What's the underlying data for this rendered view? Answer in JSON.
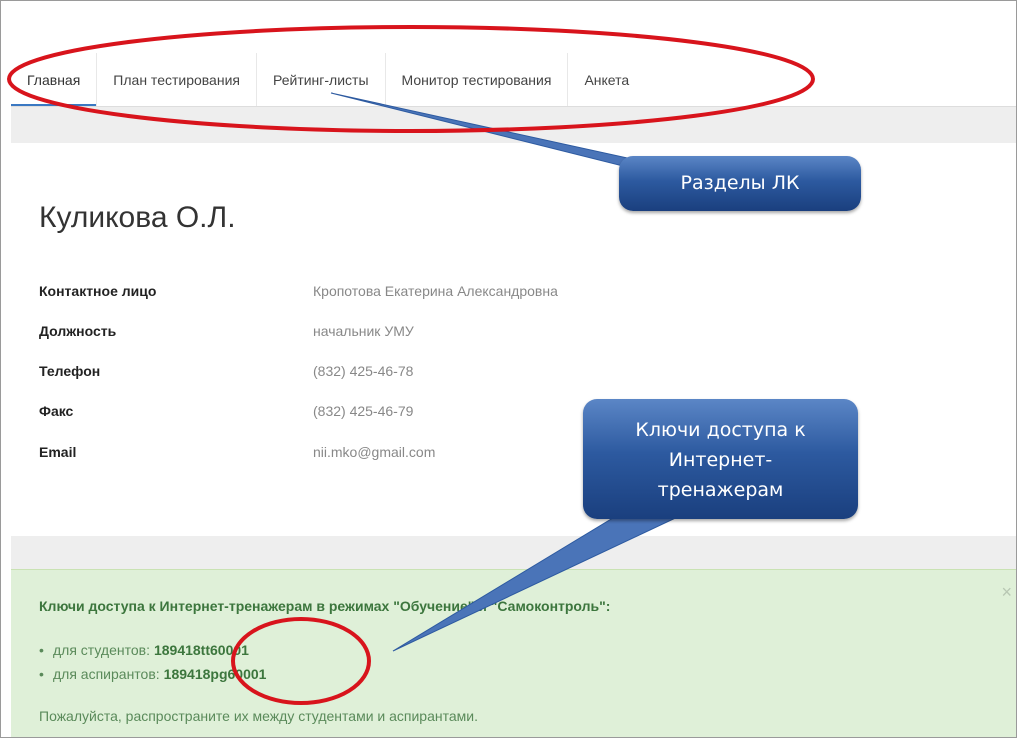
{
  "tabs": [
    {
      "label": "Главная",
      "active": true
    },
    {
      "label": "План тестирования",
      "active": false
    },
    {
      "label": "Рейтинг-листы",
      "active": false
    },
    {
      "label": "Монитор тестирования",
      "active": false
    },
    {
      "label": "Анкета",
      "active": false
    }
  ],
  "profile": {
    "org_name": "Куликова О.Л.",
    "fields": [
      {
        "label": "Контактное лицо",
        "value": "Кропотова Екатерина Александровна"
      },
      {
        "label": "Должность",
        "value": "начальник УМУ"
      },
      {
        "label": "Телефон",
        "value": "(832) 425-46-78"
      },
      {
        "label": "Факс",
        "value": "(832) 425-46-79"
      },
      {
        "label": "Email",
        "value": "nii.mko@gmail.com"
      }
    ]
  },
  "alert": {
    "title": "Ключи доступа к Интернет-тренажерам в режимах \"Обучение\" и \"Самоконтроль\":",
    "close_glyph": "×",
    "keys": [
      {
        "label": "для студентов:",
        "code": "189418tt60001"
      },
      {
        "label": "для аспирантов:",
        "code": "189418pg60001"
      }
    ],
    "note": "Пожалуйста, распространите их между студентами и аспирантами."
  },
  "callouts": {
    "sections": "Разделы ЛК",
    "keys": "Ключи доступа к\nИнтернет-\nтренажерам"
  },
  "colors": {
    "active_tab": "#3a78c2",
    "alert_bg": "#dff0d8",
    "alert_text": "#3c763d",
    "annotation_red": "#d8141c",
    "callout_blue": "#2d5aa0"
  }
}
